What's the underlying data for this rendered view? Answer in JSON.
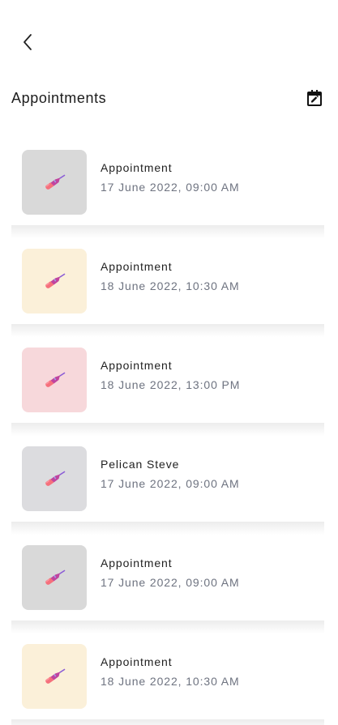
{
  "header": {
    "title": "Appointments",
    "back_icon": "chevron-left-icon",
    "calendar_icon": "calendar-edit-icon"
  },
  "appointments": [
    {
      "title": "Appointment",
      "datetime": "17 June 2022, 09:00 AM",
      "thumb_color": "#d9d9d9",
      "icon": "lipstick-icon"
    },
    {
      "title": "Appointment",
      "datetime": "18 June 2022, 10:30 AM",
      "thumb_color": "#fbf0d9",
      "icon": "lipstick-icon"
    },
    {
      "title": "Appointment",
      "datetime": "18 June 2022, 13:00 PM",
      "thumb_color": "#f7d8db",
      "icon": "lipstick-icon"
    },
    {
      "title": "Pelican Steve",
      "datetime": "17 June 2022, 09:00 AM",
      "thumb_color": "#dcdcdf",
      "icon": "lipstick-icon"
    },
    {
      "title": "Appointment",
      "datetime": "17 June 2022, 09:00 AM",
      "thumb_color": "#d9d9d9",
      "icon": "lipstick-icon"
    },
    {
      "title": "Appointment",
      "datetime": "18 June 2022, 10:30 AM",
      "thumb_color": "#fbf0d9",
      "icon": "lipstick-icon"
    }
  ]
}
